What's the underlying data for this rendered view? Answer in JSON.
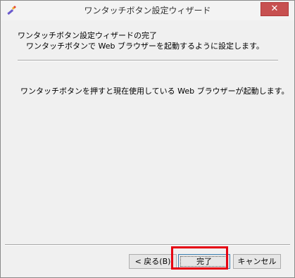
{
  "window": {
    "title": "ワンタッチボタン設定ウィザード",
    "close_label": "✕"
  },
  "header": {
    "title": "ワンタッチボタン設定ウィザードの完了",
    "subtitle": "ワンタッチボタンで Web ブラウザーを起動するように設定します。"
  },
  "body": {
    "message": "ワンタッチボタンを押すと現在使用している Web ブラウザーが起動します。"
  },
  "buttons": {
    "back": "< 戻る(B)",
    "finish": "完了",
    "cancel": "キャンセル"
  },
  "colors": {
    "highlight": "#e60012",
    "close_button": "#c75050"
  }
}
